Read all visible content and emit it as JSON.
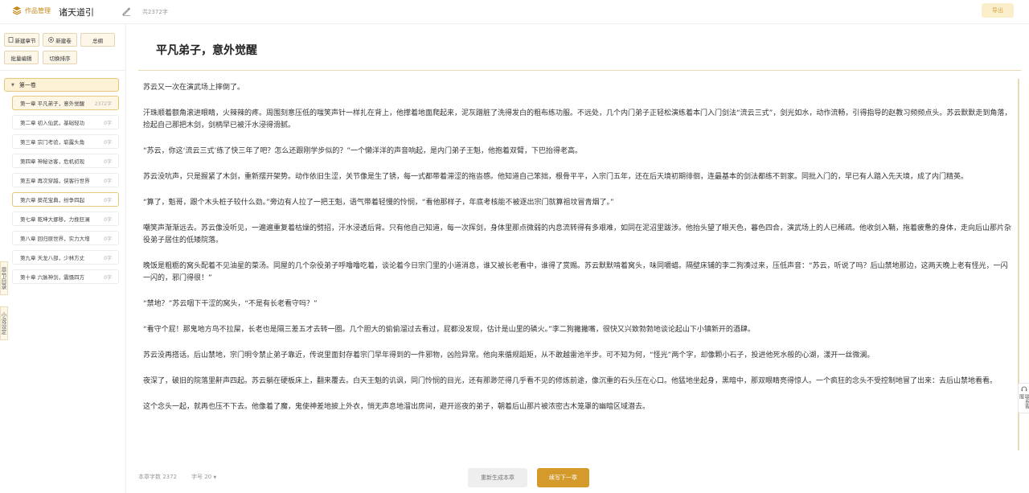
{
  "topbar": {
    "logo_text": "作品管理",
    "book_title": "诸天道引",
    "word_count": "共2372字",
    "export_label": "导出"
  },
  "sidebar": {
    "buttons": {
      "new_chapter": "新建章节",
      "new_volume": "新建卷",
      "outline": "总纲",
      "batch_edit": "批量编辑",
      "toggle_sort": "切换排序"
    },
    "volume_label": "第一卷",
    "chapters": [
      {
        "title": "第一章 平凡弟子，意外觉醒",
        "count": "2372字"
      },
      {
        "title": "第二章 初入仙武，基础轻功",
        "count": "0字"
      },
      {
        "title": "第三章 宗门考验，崭露头角",
        "count": "0字"
      },
      {
        "title": "第四章 神秘访客，危机初现",
        "count": "0字"
      },
      {
        "title": "第五章 再次穿越，侠客行世界",
        "count": "0字"
      },
      {
        "title": "第六章 葵花宝典，纷争四起",
        "count": "0字"
      },
      {
        "title": "第七章 乾坤大挪移，力挽狂澜",
        "count": "0字"
      },
      {
        "title": "第八章 回归原世界，实力大增",
        "count": "0字"
      },
      {
        "title": "第九章 天龙八部，少林方丈",
        "count": "0字"
      },
      {
        "title": "第十章 六脉神剑，震慑四方",
        "count": "0字"
      }
    ],
    "tab_catalog": "章节目录",
    "tab_settings": "小说设定"
  },
  "main": {
    "chapter_title": "平凡弟子，意外觉醒",
    "paragraphs": [
      "苏云又一次在演武场上摔倒了。",
      "汗珠顺着额角滚进眼睛，火辣辣的疼。周围刻意压低的嗤笑声针一样扎在背上，他撑着地面爬起来，泥灰蹭脏了洗得发白的粗布练功服。不远处，几个内门弟子正轻松演练着本门入门剑法“流云三式”，剑光如水，动作流畅，引得指导的赵教习频频点头。苏云默默走到角落，捡起自己那把木剑，剑柄早已被汗水浸得滑腻。",
      "“苏云，你这‘流云三式’练了快三年了吧？怎么还跟刚学步似的？”一个懒洋洋的声音响起，是内门弟子王魁，他抱着双臂，下巴抬得老高。",
      "苏云没吭声，只是握紧了木剑，重新摆开架势。动作依旧生涩，关节像是生了锈，每一式都带着滞涩的拖沓感。他知道自己笨拙，根骨平平，入宗门五年，还在后天境初期徘徊，连最基本的剑法都练不到家。同批入门的，早已有人踏入先天境，成了内门精英。",
      "“算了，魁哥，跟个木头桩子较什么劲。”旁边有人拉了一把王魁，语气带着轻慢的怜悯，“看他那样子，年底考核能不被逐出宗门就算祖坟冒青烟了。”",
      "嘲笑声渐渐远去。苏云像没听见，一遍遍重复着枯燥的劈招，汗水浸透后背。只有他自己知道，每一次挥剑，身体里那点微弱的内息流转得有多艰难，如同在泥沼里跋涉。他抬头望了眼天色，暮色四合，演武场上的人已稀疏。他收剑入鞘，拖着疲惫的身体，走向后山那片杂役弟子居住的低矮院落。",
      "晚饭是粗粝的窝头配着不见油星的菜汤。同屋的几个杂役弟子呼噜噜吃着，谈论着今日宗门里的小道消息，谁又被长老看中，谁得了赏赐。苏云默默啃着窝头，味同嚼蜡。隔壁床铺的李二狗凑过来，压低声音：“苏云，听说了吗？后山禁地那边，这两天晚上老有怪光，一闪一闪的，邪门得很！”",
      "“禁地？”苏云咽下干涩的窝头，“不是有长老看守吗？”",
      "“看守个屁！那鬼地方鸟不拉屎，长老也是隔三差五才去转一圈。几个胆大的偷偷溜过去看过，屁都没发现，估计是山里的磷火。”李二狗撇撇嘴，很快又兴致勃勃地谈论起山下小镇新开的酒肆。",
      "苏云没再搭话。后山禁地，宗门明令禁止弟子靠近，传说里面封存着宗门早年得到的一件邪物，凶险异常。他向来循规蹈矩，从不敢越雷池半步。可不知为何，“怪光”两个字，却像颗小石子，投进他死水般的心湖，漾开一丝微澜。",
      "夜深了，破旧的院落里鼾声四起。苏云躺在硬板床上，翻来覆去。白天王魁的讥讽，同门怜悯的目光，还有那渺茫得几乎看不见的修炼前途，像沉重的石头压在心口。他猛地坐起身，黑暗中，那双眼睛亮得惊人。一个疯狂的念头不受控制地冒了出来：去后山禁地看看。",
      "这个念头一起，就再也压不下去。他像着了魔，鬼使神差地披上外衣，悄无声息地溜出房间，避开巡夜的弟子，朝着后山那片被浓密古木笼罩的幽暗区域潜去。"
    ]
  },
  "footer": {
    "chapter_word_count": "本章字数 2372",
    "font_size": "字号 20",
    "regenerate_label": "重新生成本章",
    "continue_label": "续写下一章"
  },
  "floating": {
    "contact_label": "联系客服"
  },
  "colors": {
    "accent": "#d49a2c",
    "accent_light": "#fdf1d6",
    "border_accent": "#e8c77a"
  }
}
